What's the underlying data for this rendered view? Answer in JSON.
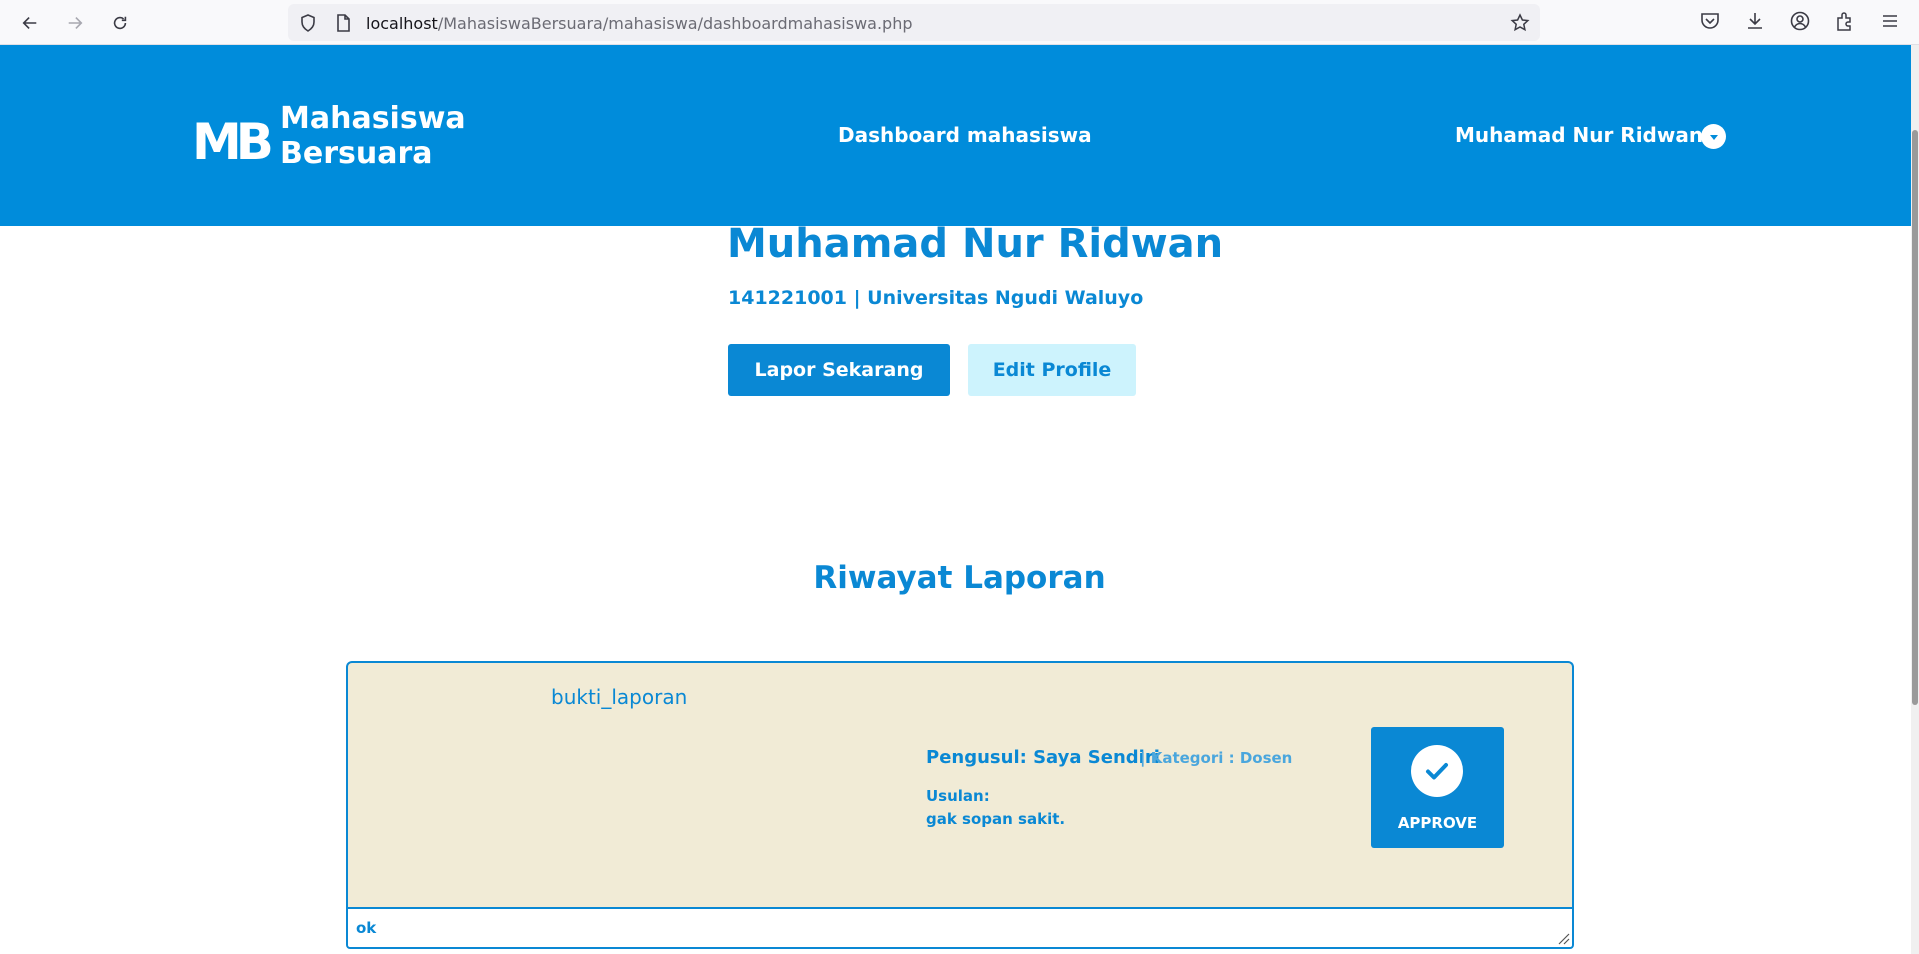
{
  "browser": {
    "url_host": "localhost",
    "url_path": "/MahasiswaBersuara/mahasiswa/dashboardmahasiswa.php"
  },
  "header": {
    "logo_mark": "MB",
    "logo_line1": "Mahasiswa",
    "logo_line2": "Bersuara",
    "nav_title": "Dashboard mahasiswa",
    "user_name": "Muhamad Nur Ridwan"
  },
  "profile": {
    "name": "Muhamad Nur Ridwan",
    "meta": "141221001 | Universitas Ngudi Waluyo",
    "report_button": "Lapor Sekarang",
    "edit_button": "Edit Profile"
  },
  "history": {
    "title": "Riwayat Laporan",
    "reports": [
      {
        "image_alt": "bukti_laporan",
        "proposer": "Pengusul: Saya Sendiri",
        "category": "| Kategori : Dosen",
        "usulan_label": "Usulan:",
        "usulan": "gak sopan sakit.",
        "status": "APPROVE",
        "response": "ok"
      }
    ]
  },
  "colors": {
    "primary": "#008cdb",
    "card_bg": "#f1ebd6",
    "secondary_btn": "#cdf3fd"
  }
}
